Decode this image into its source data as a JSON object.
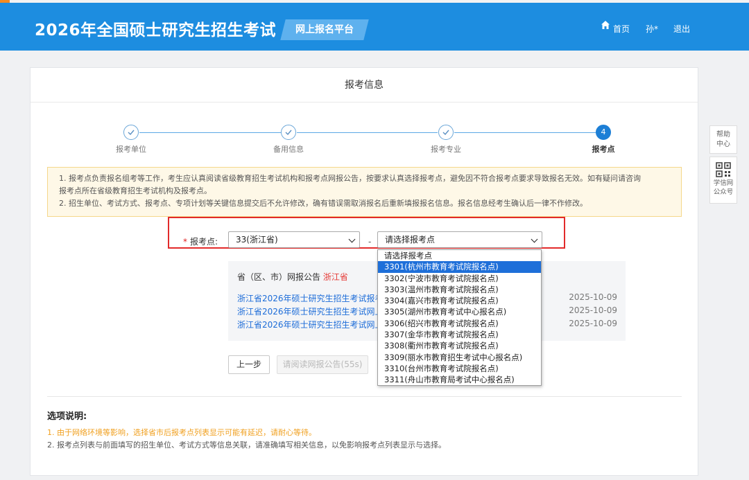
{
  "header": {
    "title": "2026年全国硕士研究生招生考试",
    "platform": "网上报名平台",
    "nav": {
      "home": "首页",
      "user": "孙*",
      "logout": "退出"
    }
  },
  "panel": {
    "title": "报考信息"
  },
  "steps": [
    {
      "label": "报考单位",
      "state": "done",
      "number": ""
    },
    {
      "label": "备用信息",
      "state": "done",
      "number": ""
    },
    {
      "label": "报考专业",
      "state": "done",
      "number": ""
    },
    {
      "label": "报考点",
      "state": "active",
      "number": "4"
    }
  ],
  "notice": {
    "line1": "1. 报考点负责报名组考等工作，考生应认真阅读省级教育招生考试机构和报考点网报公告，按要求认真选择报考点，避免因不符合报考点要求导致报名无效。如有疑问请咨询",
    "line2": "报考点所在省级教育招生考试机构及报考点。",
    "line3": "2. 招生单位、考试方式、报考点、专项计划等关键信息提交后不允许修改，确有错误需取消报名后重新填报报名信息。报名信息经考生确认后一律不作修改。"
  },
  "form": {
    "label": "报考点:",
    "province_value": "33(浙江省)",
    "separator": "-",
    "site_value": "请选择报考点"
  },
  "announcement": {
    "head_prefix": "省（区、市）网报公告",
    "province": "浙江省",
    "items": [
      {
        "title": "浙江省2026年硕士研究生招生考试报考点",
        "date": "2025-10-09"
      },
      {
        "title": "浙江省2026年硕士研究生招生考试网上报",
        "date": "2025-10-09"
      },
      {
        "title": "浙江省2026年硕士研究生招生考试网上报",
        "date": "2025-10-09"
      }
    ]
  },
  "buttons": {
    "prev": "上一步",
    "read": "请阅读网报公告(55s)"
  },
  "options": {
    "title": "选项说明:",
    "line1": "1. 由于网络环境等影响，选择省市后报考点列表显示可能有延迟，请耐心等待。",
    "line2": "2. 报考点列表与前面填写的招生单位、考试方式等信息关联，请准确填写相关信息，以免影响报考点列表显示与选择。"
  },
  "dropdown": {
    "selected_index": 1,
    "items": [
      "请选择报考点",
      "3301(杭州市教育考试院报名点)",
      "3302(宁波市教育考试院报名点)",
      "3303(温州市教育考试院报名点)",
      "3304(嘉兴市教育考试院报名点)",
      "3305(湖州市教育考试中心报名点)",
      "3306(绍兴市教育考试院报名点)",
      "3307(金华市教育考试院报名点)",
      "3308(衢州市教育考试院报名点)",
      "3309(丽水市教育招生考试中心报名点)",
      "3310(台州市教育考试院报名点)",
      "3311(舟山市教育局考试中心报名点)"
    ]
  },
  "sidebar": {
    "help": "帮助中心",
    "qr_line1": "学信网",
    "qr_line2": "公众号"
  },
  "colors": {
    "header_bg": "#1d8de0",
    "accent": "#1d7fd6",
    "highlight": "#e22a2a"
  }
}
